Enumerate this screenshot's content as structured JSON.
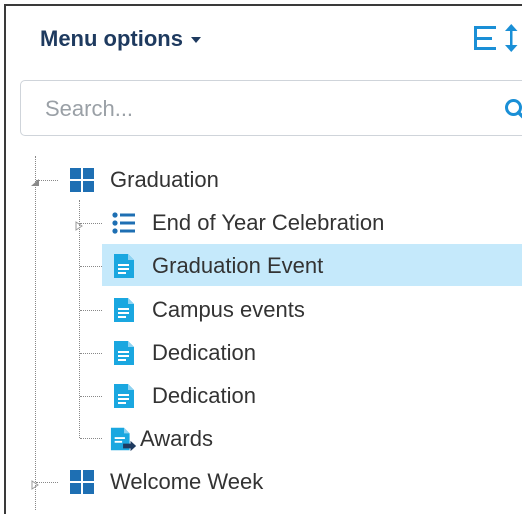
{
  "header": {
    "title": "Menu options",
    "caret_icon": "caret-down-icon",
    "tree_toggle_icon": "expand-collapse-tree-icon"
  },
  "search": {
    "placeholder": "Search...",
    "value": "",
    "icon": "search-icon"
  },
  "colors": {
    "header_text": "#1e3a5f",
    "accent": "#1a8fd6",
    "selected_row": "#c5e9fb",
    "tile_blue": "#1e6fb3"
  },
  "tree": {
    "root_1": {
      "label": "Graduation",
      "icon": "tiles-icon",
      "expanded": true,
      "children": [
        {
          "label": "End of Year Celebration",
          "icon": "list-icon",
          "expandable": true
        },
        {
          "label": "Graduation Event",
          "icon": "page-icon",
          "selected": true
        },
        {
          "label": "Campus events",
          "icon": "page-icon"
        },
        {
          "label": "Dedication",
          "icon": "page-icon"
        },
        {
          "label": "Dedication",
          "icon": "page-icon"
        },
        {
          "label": "Awards",
          "icon": "page-link-icon"
        }
      ]
    },
    "root_2": {
      "label": "Welcome Week",
      "icon": "tiles-icon",
      "expanded": false
    }
  }
}
